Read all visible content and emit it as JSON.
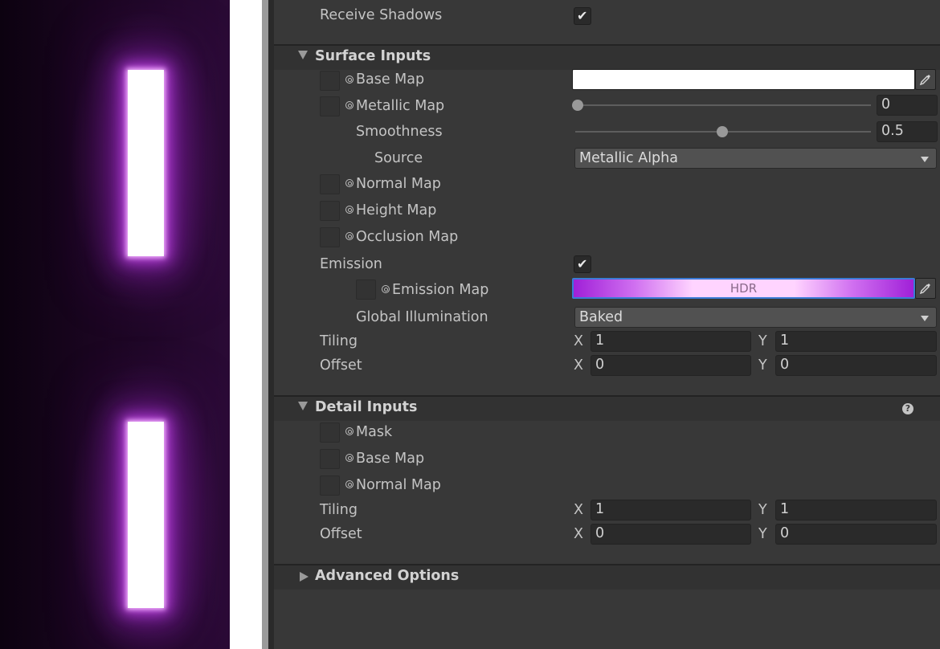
{
  "inspector": {
    "receive_shadows": {
      "label": "Receive Shadows",
      "checked": true
    },
    "surface_inputs": {
      "title": "Surface Inputs",
      "base_map": {
        "label": "Base Map",
        "color": "#ffffff"
      },
      "metallic_map": {
        "label": "Metallic Map",
        "value": "0"
      },
      "smoothness": {
        "label": "Smoothness",
        "value": "0.5"
      },
      "source": {
        "label": "Source",
        "value": "Metallic Alpha"
      },
      "normal_map": {
        "label": "Normal Map"
      },
      "height_map": {
        "label": "Height Map"
      },
      "occlusion_map": {
        "label": "Occlusion Map"
      },
      "emission": {
        "label": "Emission",
        "checked": true
      },
      "emission_map": {
        "label": "Emission Map",
        "badge": "HDR"
      },
      "global_illumination": {
        "label": "Global Illumination",
        "value": "Baked"
      },
      "tiling": {
        "label": "Tiling",
        "x_label": "X",
        "x": "1",
        "y_label": "Y",
        "y": "1"
      },
      "offset": {
        "label": "Offset",
        "x_label": "X",
        "x": "0",
        "y_label": "Y",
        "y": "0"
      }
    },
    "detail_inputs": {
      "title": "Detail Inputs",
      "mask": {
        "label": "Mask"
      },
      "base_map": {
        "label": "Base Map"
      },
      "normal_map": {
        "label": "Normal Map"
      },
      "tiling": {
        "label": "Tiling",
        "x_label": "X",
        "x": "1",
        "y_label": "Y",
        "y": "1"
      },
      "offset": {
        "label": "Offset",
        "x_label": "X",
        "x": "0",
        "y_label": "Y",
        "y": "0"
      }
    },
    "advanced_options": {
      "title": "Advanced Options"
    }
  },
  "icons": {
    "checkmark": "✔",
    "help": "?"
  },
  "colors": {
    "emission_gradient_start": "#a020d8",
    "emission_gradient_mid": "#ffd4ff",
    "scene_glow": "#b440d8"
  }
}
